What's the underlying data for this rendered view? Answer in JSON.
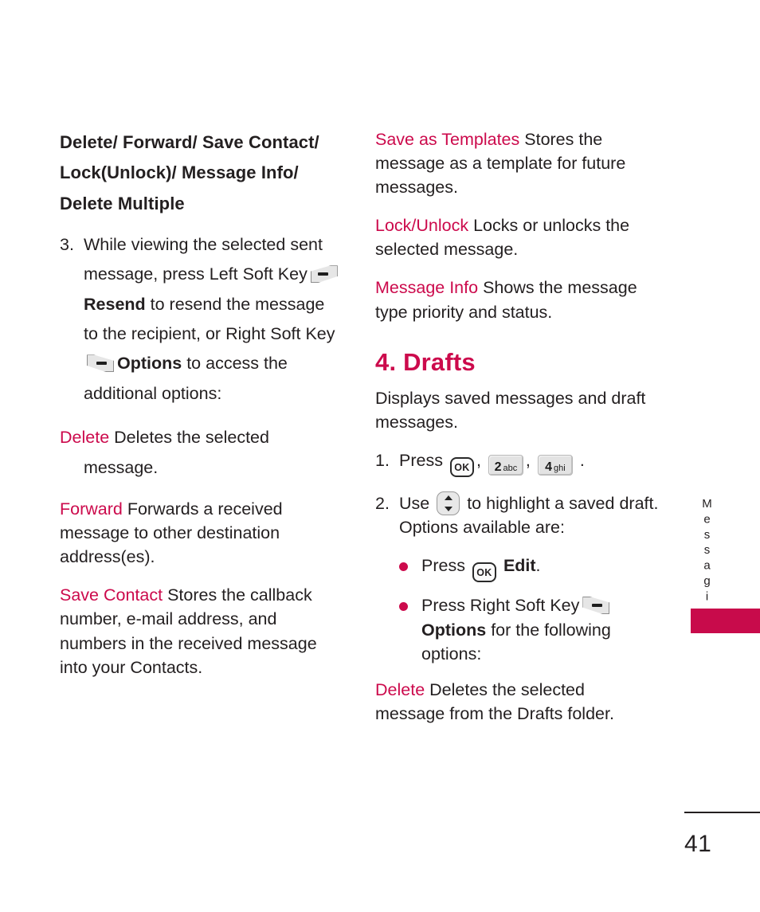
{
  "page": {
    "number": "41",
    "side_tab": "Messaging",
    "accent_color": "#cc0a4c",
    "tab_bar_color": "#c80b4b",
    "text_color": "#231f20"
  },
  "left_column": {
    "headline": "Delete/ Forward/ Save Contact/ Lock(Unlock)/ Message Info/ Delete Multiple",
    "step3": {
      "number": "3.",
      "part1": "While viewing the selected sent message, press Left Soft Key",
      "softkey_left_icon": "left-soft-key-icon",
      "bold1": "Resend",
      "part2": "to resend the message to the recipient, or Right Soft Key",
      "softkey_right_icon": "right-soft-key-icon",
      "bold2": "Options",
      "part3": "to access the additional options:"
    },
    "definitions": [
      {
        "term": "Delete",
        "text": "Deletes the selected message."
      },
      {
        "term": "Forward",
        "text": "Forwards a received message to other destination address(es)."
      },
      {
        "term": "Save Contact",
        "text": "Stores the callback number, e-mail address, and numbers in the received message into your Contacts."
      }
    ]
  },
  "right_column": {
    "definitions_top": [
      {
        "term": "Save as Templates",
        "text": "Stores the message as a template for future messages."
      },
      {
        "term": "Lock/Unlock",
        "text": "Locks or unlocks the selected message."
      },
      {
        "term": "Message Info",
        "text": "Shows the message type priority and status."
      }
    ],
    "section": {
      "heading": "4. Drafts",
      "intro": "Displays saved messages and draft messages."
    },
    "step1": {
      "number": "1.",
      "text": "Press",
      "keys": [
        {
          "type": "ok",
          "label": "OK"
        },
        {
          "type": "num",
          "digit": "2",
          "sub": "abc"
        },
        {
          "type": "num",
          "digit": "4",
          "sub": "ghi"
        }
      ],
      "comma": ",",
      "period": "."
    },
    "step2": {
      "number": "2.",
      "part1": "Use",
      "nav_icon": "nav-up-down-key-icon",
      "part2": "to highlight a saved draft. Options available are:"
    },
    "bullets": [
      {
        "pre": "Press",
        "key_ok": "OK",
        "bold": "Edit",
        "post": "."
      },
      {
        "pre": "Press Right Soft Key",
        "softkey_right_icon": "right-soft-key-icon",
        "bold": "Options",
        "post": "for the following options:"
      }
    ],
    "definition_bottom": {
      "term": "Delete",
      "text": "Deletes the selected message from the Drafts folder."
    }
  }
}
